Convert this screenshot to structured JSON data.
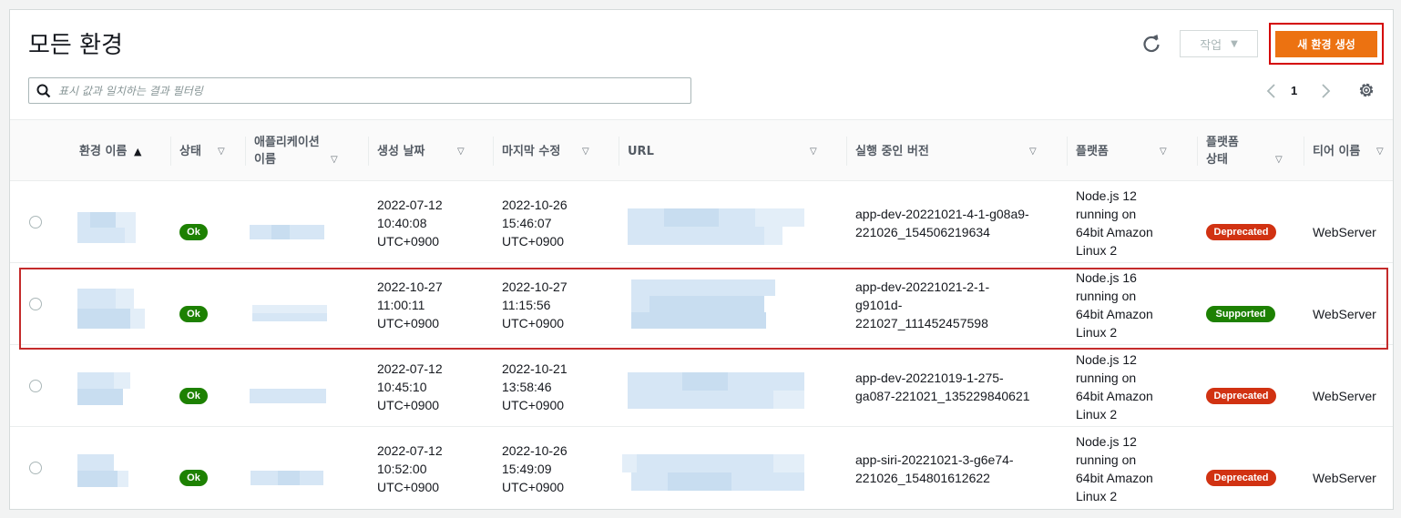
{
  "page": {
    "title": "모든 환경",
    "actions_label": "작업",
    "create_label": "새 환경 생성",
    "search_placeholder": "표시 값과 일치하는 결과 필터링",
    "current_page": "1"
  },
  "columns": [
    {
      "label": "환경 이름",
      "sorted": "asc"
    },
    {
      "label": "상태"
    },
    {
      "label": "애플리케이션 이름"
    },
    {
      "label": "생성 날짜"
    },
    {
      "label": "마지막 수정"
    },
    {
      "label": "URL"
    },
    {
      "label": "실행 중인 버전"
    },
    {
      "label": "플랫폼"
    },
    {
      "label": "플랫폼 상태"
    },
    {
      "label": "티어 이름"
    }
  ],
  "rows": [
    {
      "health": "Ok",
      "created": [
        "2022-07-12",
        "10:40:08",
        "UTC+0900"
      ],
      "modified": [
        "2022-10-26",
        "15:46:07",
        "UTC+0900"
      ],
      "version": [
        "app-dev-20221021-4-1-g08a9-",
        "221026_154506219634"
      ],
      "platform": [
        "Node.js 12",
        "running on",
        "64bit Amazon",
        "Linux 2"
      ],
      "platform_status": "Deprecated",
      "tier": "WebServer"
    },
    {
      "health": "Ok",
      "created": [
        "2022-10-27",
        "11:00:11",
        "UTC+0900"
      ],
      "modified": [
        "2022-10-27",
        "11:15:56",
        "UTC+0900"
      ],
      "version": [
        "app-dev-20221021-2-1-",
        "g9101d-",
        "221027_111452457598"
      ],
      "platform": [
        "Node.js 16",
        "running on",
        "64bit Amazon",
        "Linux 2"
      ],
      "platform_status": "Supported",
      "tier": "WebServer"
    },
    {
      "health": "Ok",
      "created": [
        "2022-07-12",
        "10:45:10",
        "UTC+0900"
      ],
      "modified": [
        "2022-10-21",
        "13:58:46",
        "UTC+0900"
      ],
      "version": [
        "app-dev-20221019-1-275-",
        "ga087-221021_135229840621"
      ],
      "platform": [
        "Node.js 12",
        "running on",
        "64bit Amazon",
        "Linux 2"
      ],
      "platform_status": "Deprecated",
      "tier": "WebServer"
    },
    {
      "health": "Ok",
      "created": [
        "2022-07-12",
        "10:52:00",
        "UTC+0900"
      ],
      "modified": [
        "2022-10-26",
        "15:49:09",
        "UTC+0900"
      ],
      "version": [
        "app-siri-20221021-3-g6e74-",
        "221026_154801612622"
      ],
      "platform": [
        "Node.js 12",
        "running on",
        "64bit Amazon",
        "Linux 2"
      ],
      "platform_status": "Deprecated",
      "tier": "WebServer"
    }
  ],
  "colors": {
    "accent": "#ec7211",
    "ok": "#1d8102",
    "deprecated": "#d13212",
    "supported": "#1d8102",
    "highlight": "#c42b2b"
  }
}
